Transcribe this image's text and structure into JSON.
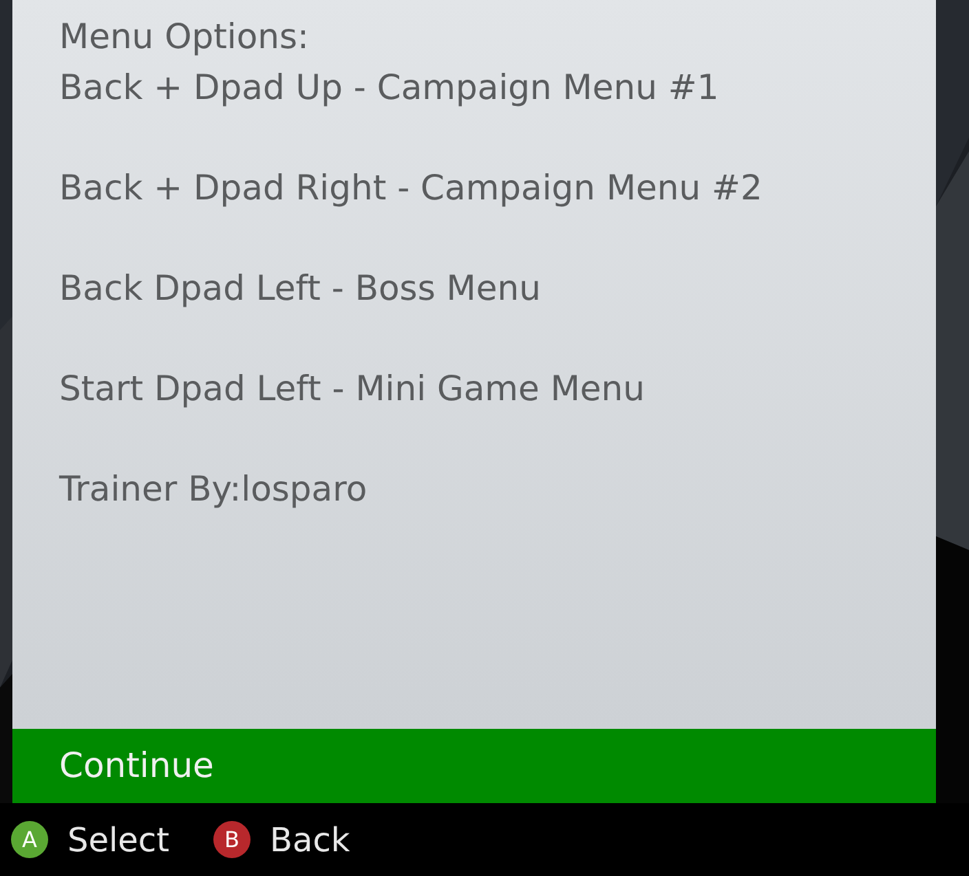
{
  "dialog": {
    "paragraphs": [
      [
        "Menu Options:",
        "Back + Dpad Up - Campaign Menu #1"
      ],
      [
        "Back + Dpad Right - Campaign Menu #2"
      ],
      [
        "Back Dpad Left - Boss Menu"
      ],
      [
        "Start Dpad Left - Mini Game Menu"
      ],
      [
        "Trainer By:losparo"
      ]
    ],
    "options": [
      {
        "label": "Continue",
        "selected": true
      }
    ]
  },
  "hints": [
    {
      "button": "A",
      "label": "Select",
      "color": "#5aa833"
    },
    {
      "button": "B",
      "label": "Back",
      "color": "#b8282c"
    }
  ]
}
